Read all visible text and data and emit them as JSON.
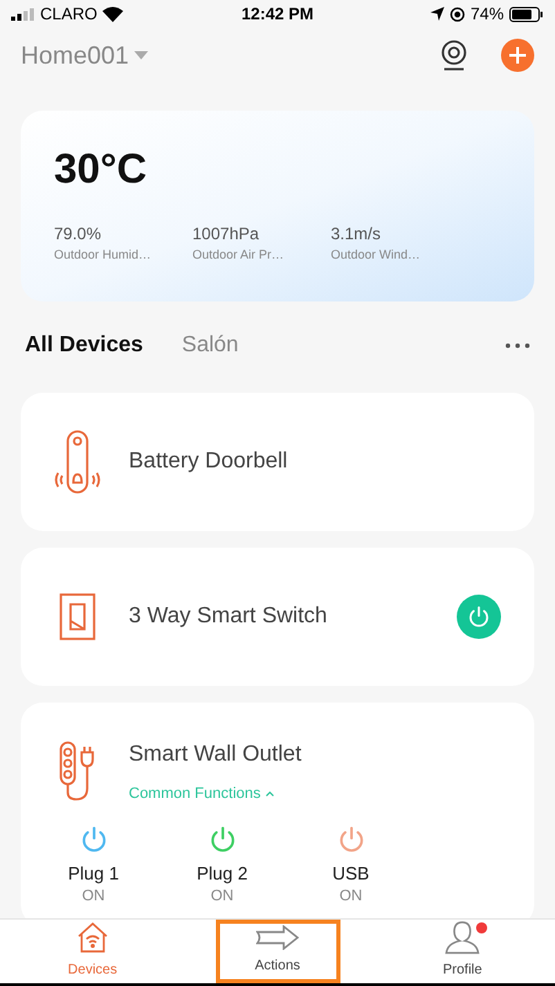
{
  "status_bar": {
    "carrier": "CLARO",
    "time": "12:42 PM",
    "battery": "74%"
  },
  "header": {
    "home": "Home001"
  },
  "weather": {
    "temperature": "30°C",
    "stats": [
      {
        "value": "79.0%",
        "label": "Outdoor Humid…"
      },
      {
        "value": "1007hPa",
        "label": "Outdoor Air Pr…"
      },
      {
        "value": "3.1m/s",
        "label": "Outdoor Wind…"
      }
    ]
  },
  "tabs": [
    {
      "label": "All Devices",
      "selected": true
    },
    {
      "label": "Salón",
      "selected": false
    }
  ],
  "devices": [
    {
      "kind": "doorbell",
      "name": "Battery Doorbell"
    },
    {
      "kind": "switch",
      "name": "3 Way Smart Switch",
      "on": true
    },
    {
      "kind": "outlet",
      "name": "Smart Wall Outlet",
      "functions": "Common Functions",
      "expanded": true,
      "plugs": [
        {
          "name": "Plug 1",
          "state": "ON",
          "color": "#4fb8f0"
        },
        {
          "name": "Plug 2",
          "state": "ON",
          "color": "#3ecf63"
        },
        {
          "name": "USB",
          "state": "ON",
          "color": "#f2a488"
        }
      ]
    }
  ],
  "tab_bar": [
    {
      "kind": "devices",
      "label": "Devices",
      "selected": true,
      "highlighted": false,
      "badge": false
    },
    {
      "kind": "actions",
      "label": "Actions",
      "selected": false,
      "highlighted": true,
      "badge": false
    },
    {
      "kind": "profile",
      "label": "Profile",
      "selected": false,
      "highlighted": false,
      "badge": true
    }
  ]
}
